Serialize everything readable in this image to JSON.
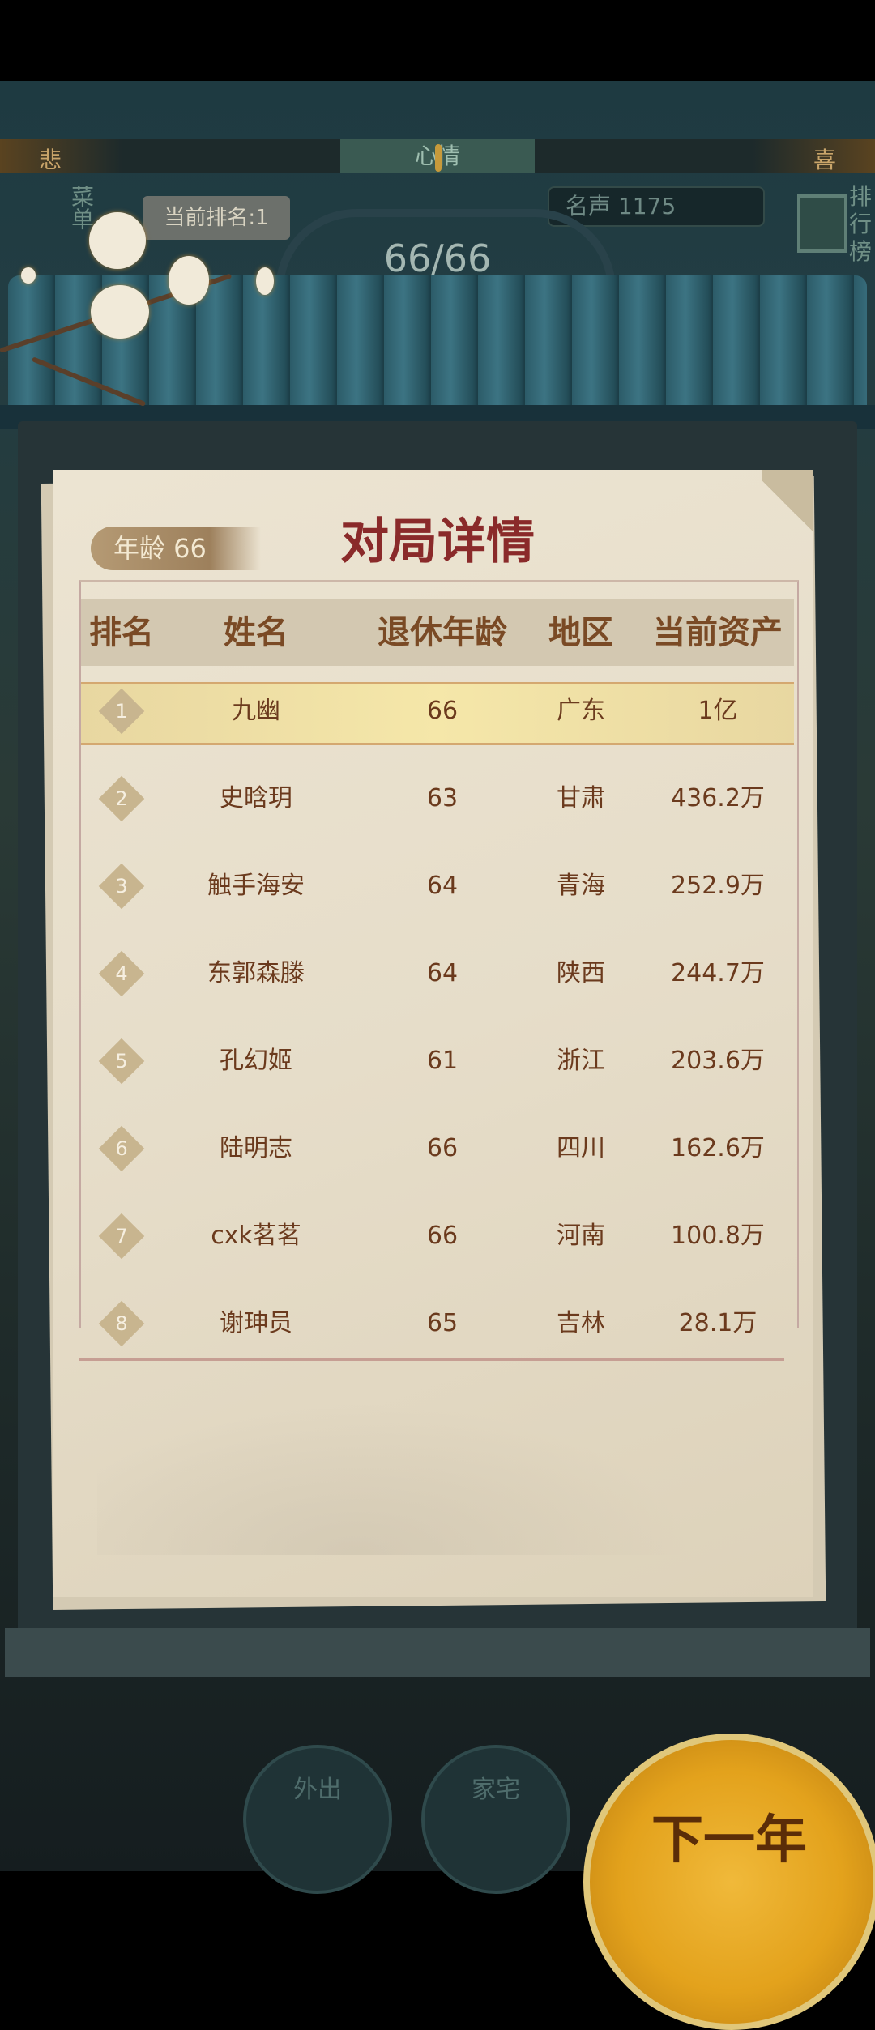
{
  "mood": {
    "sad": "悲",
    "center": "心情",
    "happy": "喜"
  },
  "sidebar": {
    "menu": "菜单",
    "leaderboard": "排行榜"
  },
  "status": {
    "current_rank": "当前排名:1",
    "fame": "名声 1175",
    "progress": "66/66"
  },
  "panel": {
    "title": "对局详情",
    "age_tag": "年龄 66",
    "headers": [
      "排名",
      "姓名",
      "退休年龄",
      "地区",
      "当前资产"
    ],
    "rows": [
      {
        "rank": "1",
        "name": "九幽",
        "retire_age": "66",
        "region": "广东",
        "assets": "1亿"
      },
      {
        "rank": "2",
        "name": "史晗玥",
        "retire_age": "63",
        "region": "甘肃",
        "assets": "436.2万"
      },
      {
        "rank": "3",
        "name": "触手海安",
        "retire_age": "64",
        "region": "青海",
        "assets": "252.9万"
      },
      {
        "rank": "4",
        "name": "东郭森滕",
        "retire_age": "64",
        "region": "陕西",
        "assets": "244.7万"
      },
      {
        "rank": "5",
        "name": "孔幻姬",
        "retire_age": "61",
        "region": "浙江",
        "assets": "203.6万"
      },
      {
        "rank": "6",
        "name": "陆明志",
        "retire_age": "66",
        "region": "四川",
        "assets": "162.6万"
      },
      {
        "rank": "7",
        "name": "cxk茗茗",
        "retire_age": "66",
        "region": "河南",
        "assets": "100.8万"
      },
      {
        "rank": "8",
        "name": "谢珅员",
        "retire_age": "65",
        "region": "吉林",
        "assets": "28.1万"
      }
    ]
  },
  "bottom": {
    "go_out": "外出",
    "home": "家宅",
    "next_year": "下一年"
  }
}
